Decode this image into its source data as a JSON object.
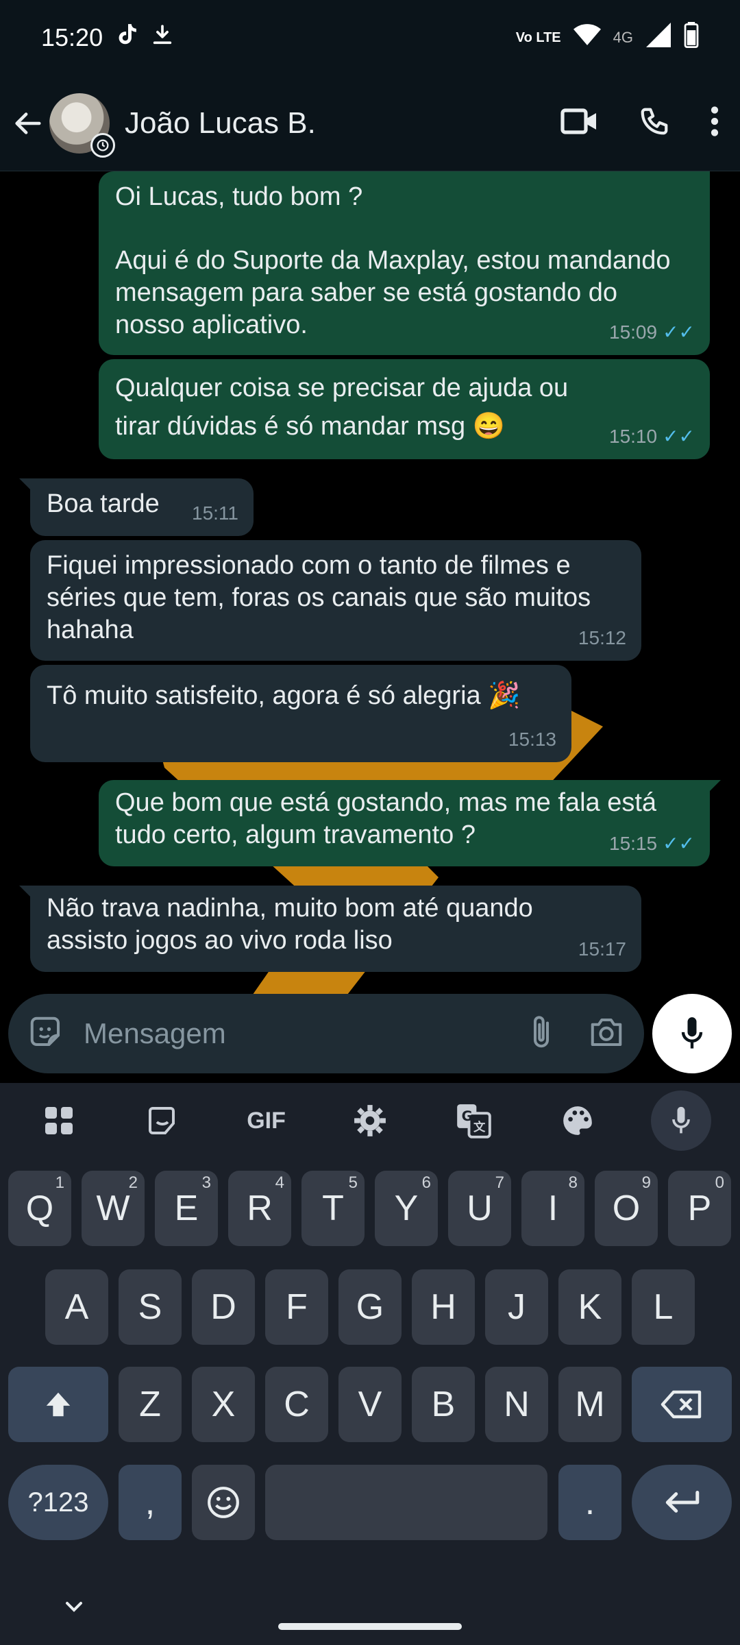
{
  "status_bar": {
    "time": "15:20",
    "icons_left": [
      "tiktok-icon",
      "download-icon"
    ],
    "network_label": "Vo LTE",
    "network_type": "4G",
    "icons_right": [
      "volte-icon",
      "wifi-icon",
      "signal-icon",
      "battery-icon"
    ]
  },
  "header": {
    "contact_name": "João Lucas B.",
    "actions": [
      "video-call-icon",
      "voice-call-icon",
      "more-options-icon"
    ]
  },
  "messages": [
    {
      "direction": "out",
      "text_line1": "Oi Lucas, tudo bom ?",
      "text_line2": "",
      "text_body": "Aqui é do Suporte da Maxplay, estou mandando mensagem para saber se está gostando do nosso aplicativo.",
      "time": "15:09",
      "status": "read"
    },
    {
      "direction": "out",
      "text": "Qualquer coisa se precisar de ajuda ou tirar dúvidas é só mandar msg 😄",
      "time": "15:10",
      "status": "read"
    },
    {
      "direction": "in",
      "text": "Boa tarde",
      "time": "15:11"
    },
    {
      "direction": "in",
      "text": "Fiquei impressionado com o tanto de filmes e séries que tem, foras os canais que são muitos hahaha",
      "time": "15:12"
    },
    {
      "direction": "in",
      "text": "Tô muito satisfeito, agora é só alegria 🎉",
      "time": "15:13"
    },
    {
      "direction": "out",
      "text": "Que bom que está gostando, mas me fala está tudo certo, algum travamento ?",
      "time": "15:15",
      "status": "read"
    },
    {
      "direction": "in",
      "text": "Não trava nadinha, muito bom até quando assisto jogos ao vivo roda liso",
      "time": "15:17"
    }
  ],
  "read_tick": "✓✓",
  "composer": {
    "placeholder": "Mensagem",
    "icons": [
      "sticker-icon",
      "attach-icon",
      "camera-icon",
      "mic-icon"
    ]
  },
  "keyboard": {
    "toolbar": [
      "apps-grid-icon",
      "sticker-icon",
      "GIF",
      "settings-icon",
      "translate-icon",
      "palette-icon",
      "voice-input-icon"
    ],
    "gif_label": "GIF",
    "row1": [
      "Q",
      "W",
      "E",
      "R",
      "T",
      "Y",
      "U",
      "I",
      "O",
      "P"
    ],
    "row1_hints": [
      "1",
      "2",
      "3",
      "4",
      "5",
      "6",
      "7",
      "8",
      "9",
      "0"
    ],
    "row2": [
      "A",
      "S",
      "D",
      "F",
      "G",
      "H",
      "J",
      "K",
      "L"
    ],
    "row3": [
      "Z",
      "X",
      "C",
      "V",
      "B",
      "N",
      "M"
    ],
    "symbols_label": "?123",
    "comma_label": ",",
    "period_label": "."
  },
  "colors": {
    "outgoing_bubble": "#144d37",
    "incoming_bubble": "#1f2c34",
    "read_tick": "#53bdeb",
    "header_bg": "#0b141a",
    "keyboard_bg": "#1b2029"
  }
}
